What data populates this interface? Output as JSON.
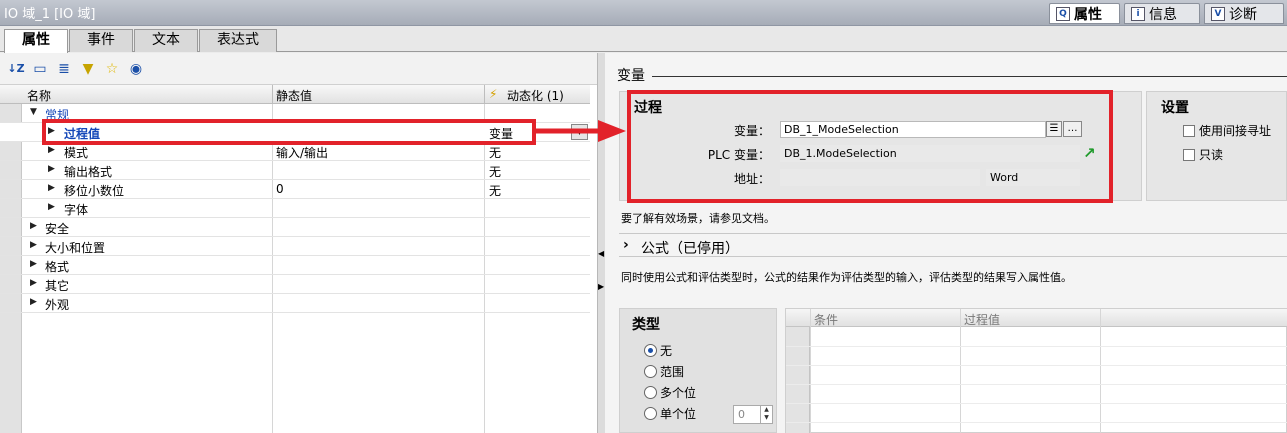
{
  "window": {
    "title": "IO 域_1 [IO 域]"
  },
  "inspector_tabs": [
    {
      "label": "属性",
      "icon": "properties-icon"
    },
    {
      "label": "信息",
      "icon": "info-icon"
    },
    {
      "label": "诊断",
      "icon": "diagnostics-icon"
    }
  ],
  "main_tabs": [
    "属性",
    "事件",
    "文本",
    "表达式"
  ],
  "toolbar_icons": [
    "sort-az-icon",
    "expand-icon",
    "list-icon",
    "filter-icon",
    "favorite-icon",
    "eye-icon"
  ],
  "table": {
    "columns": [
      "名称",
      "静态值",
      "动态化 (1)"
    ],
    "rows": [
      {
        "label": "常规",
        "static": "",
        "dynamic": "",
        "level": 0,
        "expanded": true
      },
      {
        "label": "过程值",
        "static": "",
        "dynamic": "变量",
        "level": 1,
        "selected": true
      },
      {
        "label": "模式",
        "static": "输入/输出",
        "dynamic": "无",
        "level": 1
      },
      {
        "label": "输出格式",
        "static": "",
        "dynamic": "无",
        "level": 1
      },
      {
        "label": "移位小数位",
        "static": "0",
        "dynamic": "无",
        "level": 1
      },
      {
        "label": "字体",
        "static": "",
        "dynamic": "",
        "level": 1
      },
      {
        "label": "安全",
        "static": "",
        "dynamic": "",
        "level": 0
      },
      {
        "label": "大小和位置",
        "static": "",
        "dynamic": "",
        "level": 0
      },
      {
        "label": "格式",
        "static": "",
        "dynamic": "",
        "level": 0
      },
      {
        "label": "其它",
        "static": "",
        "dynamic": "",
        "level": 0
      },
      {
        "label": "外观",
        "static": "",
        "dynamic": "",
        "level": 0
      }
    ]
  },
  "right": {
    "section_title": "变量",
    "process": {
      "header": "过程",
      "variable_label": "变量：",
      "variable_value": "DB_1_ModeSelection",
      "plc_label": "PLC 变量：",
      "plc_value": "DB_1.ModeSelection",
      "address_label": "地址：",
      "address_value": "",
      "type_value": "Word"
    },
    "settings": {
      "header": "设置",
      "indirect_label": "使用间接寻址",
      "readonly_label": "只读"
    },
    "scenario_note": "要了解有效场景，请参见文档。",
    "formula_title": "公式（已停用）",
    "formula_note": "同时使用公式和评估类型时，公式的结果作为评估类型的输入，评估类型的结果写入属性值。",
    "type_box": {
      "header": "类型",
      "options": [
        "无",
        "范围",
        "多个位",
        "单个位"
      ],
      "selected": "无",
      "bit_value": "0"
    },
    "condition_grid": {
      "columns": [
        "条件",
        "过程值"
      ]
    }
  },
  "colors": {
    "highlight": "#e2222a",
    "accent": "#1346b8"
  }
}
